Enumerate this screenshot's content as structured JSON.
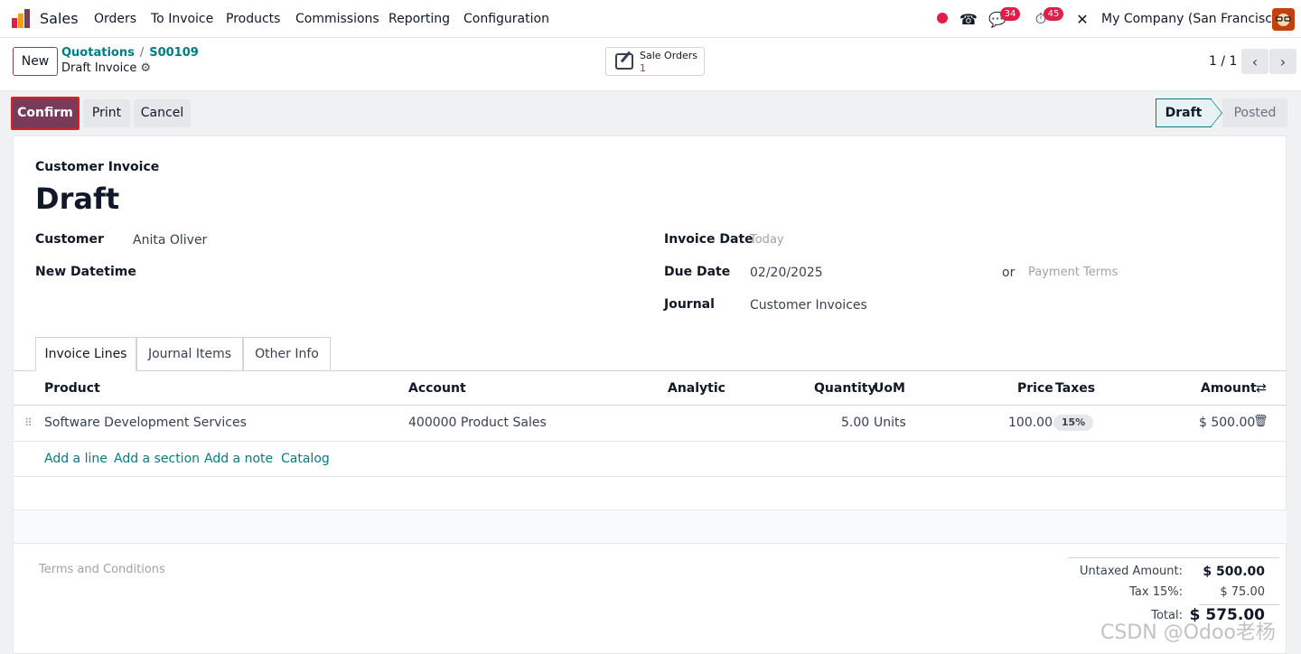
{
  "navbar": {
    "app_name": "Sales",
    "menu": [
      "Orders",
      "To Invoice",
      "Products",
      "Commissions",
      "Reporting",
      "Configuration"
    ],
    "chat_badge": "34",
    "activity_badge": "45",
    "company": "My Company (San Francisco)",
    "status_dot_color": "#e11d48",
    "icons": [
      "phone-icon",
      "chat-icon",
      "clock-icon",
      "tools-icon"
    ]
  },
  "control_panel": {
    "new_label": "New",
    "breadcrumb": [
      "Quotations",
      "S00109"
    ],
    "breadcrumb_sep": "/",
    "subtitle": "Draft Invoice",
    "smart_button": {
      "label": "Sale Orders",
      "count": "1"
    },
    "pager": "1 / 1"
  },
  "actions": {
    "confirm": "Confirm",
    "print": "Print",
    "cancel": "Cancel"
  },
  "statusbar": {
    "steps": [
      "Draft",
      "Posted"
    ],
    "active": "Draft"
  },
  "form": {
    "doc_type": "Customer Invoice",
    "title": "Draft",
    "customer_label": "Customer",
    "customer_value": "Anita Oliver",
    "new_datetime_label": "New Datetime",
    "invoice_date_label": "Invoice Date",
    "invoice_date_placeholder": "Today",
    "due_date_label": "Due Date",
    "due_date_value": "02/20/2025",
    "or_label": "or",
    "payment_terms_placeholder": "Payment Terms",
    "journal_label": "Journal",
    "journal_value": "Customer Invoices"
  },
  "tabs": [
    "Invoice Lines",
    "Journal Items",
    "Other Info"
  ],
  "table": {
    "headers": {
      "product": "Product",
      "account": "Account",
      "analytic": "Analytic",
      "quantity": "Quantity",
      "uom": "UoM",
      "price": "Price",
      "taxes": "Taxes",
      "amount": "Amount"
    },
    "rows": [
      {
        "product": "Software Development Services",
        "account": "400000 Product Sales",
        "analytic": "",
        "quantity": "5.00",
        "uom": "Units",
        "price": "100.00",
        "tax": "15%",
        "amount": "$ 500.00"
      }
    ],
    "add_links": [
      "Add a line",
      "Add a section",
      "Add a note",
      "Catalog"
    ]
  },
  "footer": {
    "terms_placeholder": "Terms and Conditions",
    "untaxed_label": "Untaxed Amount:",
    "untaxed_value": "$ 500.00",
    "tax_label": "Tax 15%:",
    "tax_value": "$ 75.00",
    "total_label": "Total:",
    "total_value": "$ 575.00"
  },
  "watermark": "CSDN @Odoo老杨",
  "colors": {
    "brand": "#7a3a5a",
    "link": "#017e84",
    "badge": "#e11d48"
  }
}
